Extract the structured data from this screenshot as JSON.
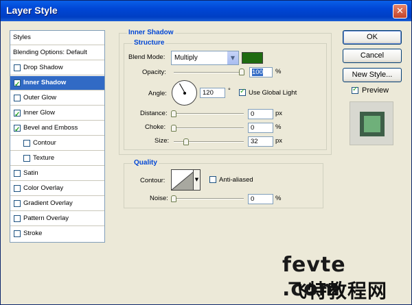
{
  "window": {
    "title": "Layer Style",
    "close_glyph": "✕"
  },
  "sidebar": {
    "header": "Styles",
    "items": [
      {
        "label": "Blending Options: Default",
        "has_checkbox": false,
        "checked": false
      },
      {
        "label": "Drop Shadow",
        "has_checkbox": true,
        "checked": false
      },
      {
        "label": "Inner Shadow",
        "has_checkbox": true,
        "checked": true,
        "selected": true
      },
      {
        "label": "Outer Glow",
        "has_checkbox": true,
        "checked": false
      },
      {
        "label": "Inner Glow",
        "has_checkbox": true,
        "checked": true
      },
      {
        "label": "Bevel and Emboss",
        "has_checkbox": true,
        "checked": true
      },
      {
        "label": "Contour",
        "has_checkbox": true,
        "checked": false,
        "indent": true
      },
      {
        "label": "Texture",
        "has_checkbox": true,
        "checked": false,
        "indent": true
      },
      {
        "label": "Satin",
        "has_checkbox": true,
        "checked": false
      },
      {
        "label": "Color Overlay",
        "has_checkbox": true,
        "checked": false
      },
      {
        "label": "Gradient Overlay",
        "has_checkbox": true,
        "checked": false
      },
      {
        "label": "Pattern Overlay",
        "has_checkbox": true,
        "checked": false
      },
      {
        "label": "Stroke",
        "has_checkbox": true,
        "checked": false
      }
    ]
  },
  "inner_shadow": {
    "section_title": "Inner Shadow",
    "structure_title": "Structure",
    "blend_mode_label": "Blend Mode:",
    "blend_mode_value": "Multiply",
    "shadow_color": "#1f6b10",
    "opacity_label": "Opacity:",
    "opacity_value": "100",
    "opacity_unit": "%",
    "angle_label": "Angle:",
    "angle_value": "120",
    "angle_unit": "°",
    "use_global_light_label": "Use Global Light",
    "use_global_light_checked": true,
    "distance_label": "Distance:",
    "distance_value": "0",
    "distance_unit": "px",
    "choke_label": "Choke:",
    "choke_value": "0",
    "choke_unit": "%",
    "size_label": "Size:",
    "size_value": "32",
    "size_unit": "px"
  },
  "quality": {
    "title": "Quality",
    "contour_label": "Contour:",
    "anti_aliased_label": "Anti-aliased",
    "anti_aliased_checked": false,
    "noise_label": "Noise:",
    "noise_value": "0",
    "noise_unit": "%"
  },
  "buttons": {
    "ok": "OK",
    "cancel": "Cancel",
    "new_style": "New Style...",
    "preview_label": "Preview",
    "preview_checked": true
  },
  "watermark": {
    "line1": "fevte .com",
    "line2": "飞特教程网"
  }
}
